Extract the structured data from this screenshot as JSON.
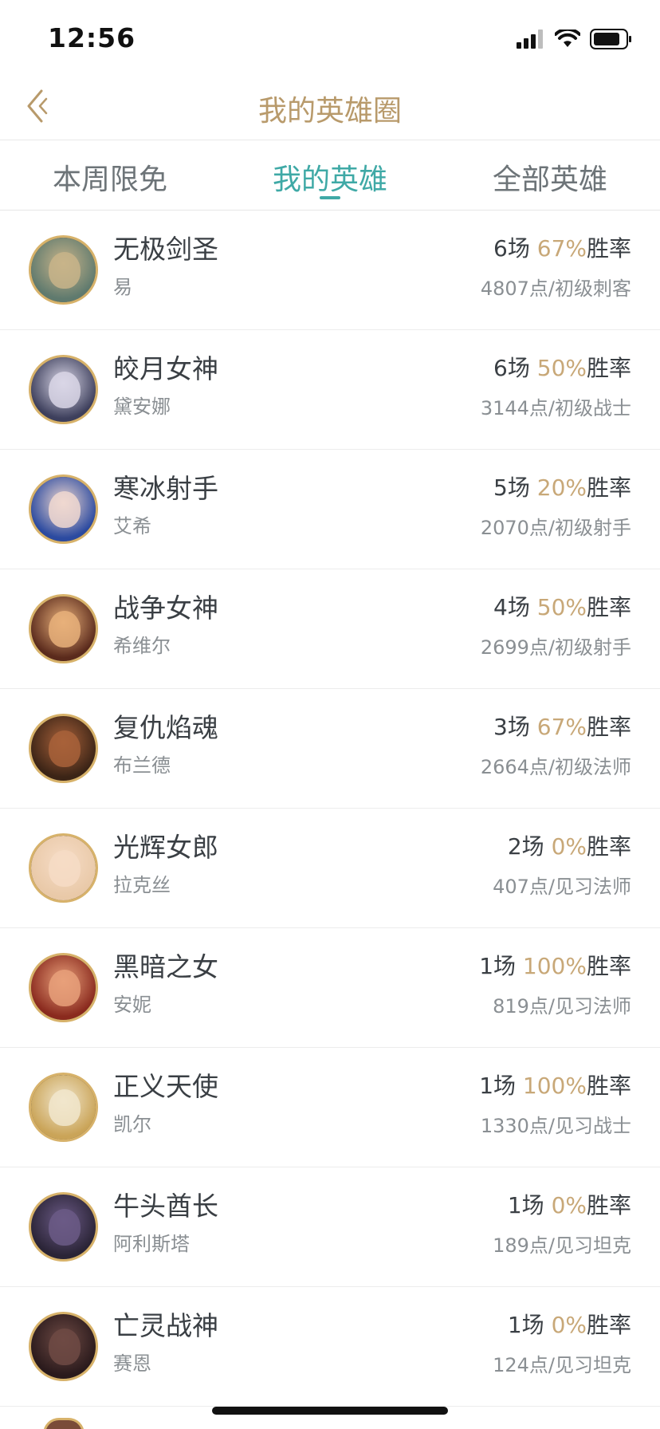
{
  "status_bar": {
    "time": "12:56",
    "icons": [
      "signal-icon",
      "wifi-icon",
      "battery-icon"
    ]
  },
  "nav": {
    "title": "我的英雄圈",
    "back_icon": "chevron-left-icon"
  },
  "tabs": [
    {
      "label": "本周限免",
      "active": false
    },
    {
      "label": "我的英雄",
      "active": true
    },
    {
      "label": "全部英雄",
      "active": false
    }
  ],
  "colors": {
    "accent": "#3fa9a6",
    "gold": "#b89a6b",
    "rate": "#c8a878",
    "avatar_border": "#d7b26a"
  },
  "heroes": [
    {
      "name": "无极剑圣",
      "sub": "易",
      "games": "6场",
      "rate": "67%",
      "rate_suffix": "胜率",
      "points": "4807点/初级刺客",
      "avatar_color": "#5f7a6e",
      "face_color": "#c8b48a"
    },
    {
      "name": "皎月女神",
      "sub": "黛安娜",
      "games": "6场",
      "rate": "50%",
      "rate_suffix": "胜率",
      "points": "3144点/初级战士",
      "avatar_color": "#3d3f5c",
      "face_color": "#d9d6e6"
    },
    {
      "name": "寒冰射手",
      "sub": "艾希",
      "games": "5场",
      "rate": "20%",
      "rate_suffix": "胜率",
      "points": "2070点/初级射手",
      "avatar_color": "#2b4aa0",
      "face_color": "#f0d8d0"
    },
    {
      "name": "战争女神",
      "sub": "希维尔",
      "games": "4场",
      "rate": "50%",
      "rate_suffix": "胜率",
      "points": "2699点/初级射手",
      "avatar_color": "#5a2a1c",
      "face_color": "#e8b07a"
    },
    {
      "name": "复仇焰魂",
      "sub": "布兰德",
      "games": "3场",
      "rate": "67%",
      "rate_suffix": "胜率",
      "points": "2664点/初级法师",
      "avatar_color": "#3b2416",
      "face_color": "#a8613a"
    },
    {
      "name": "光辉女郎",
      "sub": "拉克丝",
      "games": "2场",
      "rate": "0%",
      "rate_suffix": "胜率",
      "points": "407点/见习法师",
      "avatar_color": "#e9c9a8",
      "face_color": "#f6dcc6"
    },
    {
      "name": "黑暗之女",
      "sub": "安妮",
      "games": "1场",
      "rate": "100%",
      "rate_suffix": "胜率",
      "points": "819点/见习法师",
      "avatar_color": "#8a2a1e",
      "face_color": "#e8a07a"
    },
    {
      "name": "正义天使",
      "sub": "凯尔",
      "games": "1场",
      "rate": "100%",
      "rate_suffix": "胜率",
      "points": "1330点/见习战士",
      "avatar_color": "#caa458",
      "face_color": "#f1e6cc"
    },
    {
      "name": "牛头酋长",
      "sub": "阿利斯塔",
      "games": "1场",
      "rate": "0%",
      "rate_suffix": "胜率",
      "points": "189点/见习坦克",
      "avatar_color": "#2a2436",
      "face_color": "#6b5a86"
    },
    {
      "name": "亡灵战神",
      "sub": "赛恩",
      "games": "1场",
      "rate": "0%",
      "rate_suffix": "胜率",
      "points": "124点/见习坦克",
      "avatar_color": "#2a1a1c",
      "face_color": "#6e4a44"
    }
  ]
}
